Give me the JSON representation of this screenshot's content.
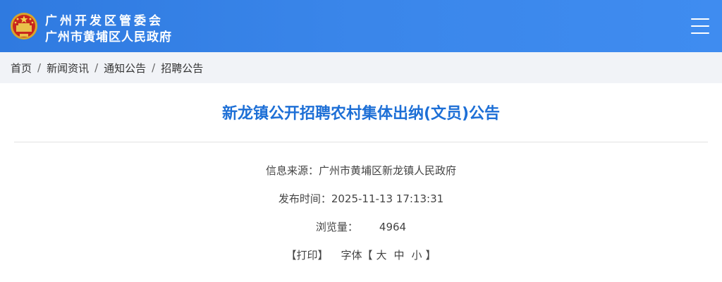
{
  "header": {
    "brand_line1": "广州开发区管委会",
    "brand_line2": "广州市黄埔区人民政府",
    "menu_icon": "hamburger-menu-icon",
    "emblem_icon": "national-emblem-icon",
    "colors": {
      "header_bg": "#3a86ea",
      "title": "#1d6fd6",
      "breadcrumb_bg": "#f1f3f7"
    }
  },
  "breadcrumb": {
    "items": [
      "首页",
      "新闻资讯",
      "通知公告",
      "招聘公告"
    ],
    "separator": "/"
  },
  "article": {
    "title": "新龙镇公开招聘农村集体出纳(文员)公告",
    "source_label": "信息来源：",
    "source_value": "广州市黄埔区新龙镇人民政府",
    "time_label": "发布时间：",
    "time_value": "2025-11-13 17:13:31",
    "views_label": "浏览量：",
    "views_value": "4964",
    "print_label": "【打印】",
    "font_label": "字体【",
    "font_sizes": [
      "大",
      "中",
      "小"
    ],
    "font_close": "】"
  }
}
